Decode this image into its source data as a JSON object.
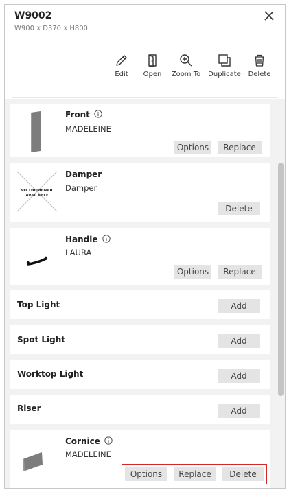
{
  "header": {
    "title": "W9002",
    "dimensions": "W900 x D370 x H800"
  },
  "toolbar": [
    {
      "label": "Edit",
      "icon": "pencil-icon"
    },
    {
      "label": "Open",
      "icon": "door-icon"
    },
    {
      "label": "Zoom To",
      "icon": "zoom-in-icon"
    },
    {
      "label": "Duplicate",
      "icon": "duplicate-icon"
    },
    {
      "label": "Delete",
      "icon": "trash-icon"
    }
  ],
  "items": {
    "front": {
      "name": "Front",
      "value": "MADELEINE",
      "options_label": "Options",
      "replace_label": "Replace"
    },
    "damper": {
      "name": "Damper",
      "value": "Damper",
      "thumb_text_line1": "NO THUMBNAIL",
      "thumb_text_line2": "AVAILABLE",
      "delete_label": "Delete"
    },
    "handle": {
      "name": "Handle",
      "value": "LAURA",
      "options_label": "Options",
      "replace_label": "Replace"
    },
    "top_light": {
      "name": "Top Light",
      "add_label": "Add"
    },
    "spot_light": {
      "name": "Spot Light",
      "add_label": "Add"
    },
    "worktop_light": {
      "name": "Worktop Light",
      "add_label": "Add"
    },
    "riser": {
      "name": "Riser",
      "add_label": "Add"
    },
    "cornice": {
      "name": "Cornice",
      "value": "MADELEINE",
      "options_label": "Options",
      "replace_label": "Replace",
      "delete_label": "Delete"
    }
  },
  "colors": {
    "highlight_border": "#d62828",
    "button_bg": "#e4e4e4",
    "list_bg": "#f2f2f2"
  }
}
